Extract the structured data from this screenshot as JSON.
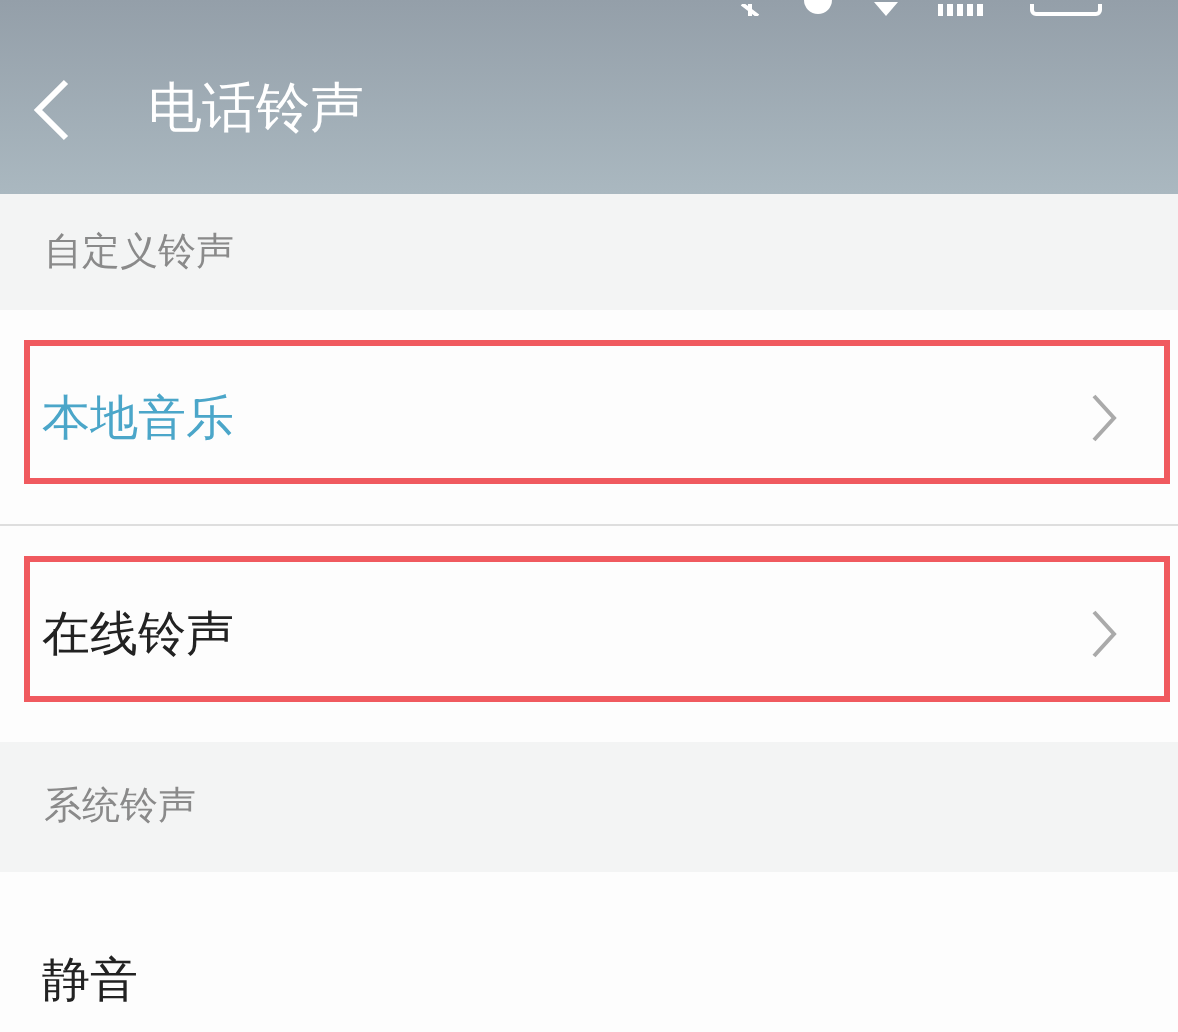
{
  "header": {
    "title": "电话铃声"
  },
  "sections": [
    {
      "title": "自定义铃声",
      "items": [
        {
          "label": "本地音乐",
          "accent": true,
          "chevron": true,
          "outlined": true
        },
        {
          "label": "在线铃声",
          "accent": false,
          "chevron": true,
          "outlined": true
        }
      ]
    },
    {
      "title": "系统铃声",
      "items": [
        {
          "label": "静音",
          "accent": false,
          "chevron": false,
          "outlined": false
        }
      ]
    }
  ]
}
